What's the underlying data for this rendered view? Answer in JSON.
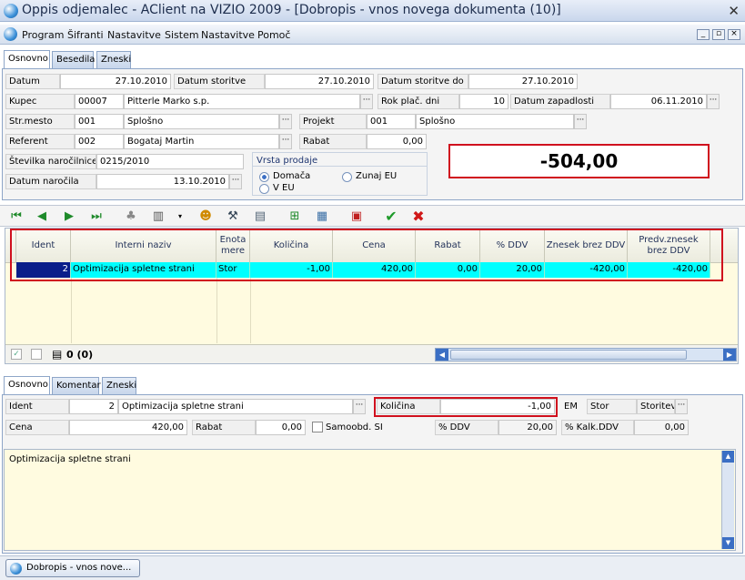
{
  "window": {
    "title": "Oppis odjemalec - AClient na VIZIO 2009 - [Dobropis - vnos novega dokumenta (10)]"
  },
  "menu": [
    "Program",
    "Šifranti",
    "Nastavitve",
    "Sistem",
    "Nastavitve",
    "Pomoč"
  ],
  "top_tabs": [
    "Osnovno",
    "Besedila",
    "Zneski"
  ],
  "header": {
    "datum_label": "Datum",
    "datum_value": "27.10.2010",
    "datum_storitve_label": "Datum storitve",
    "datum_storitve_value": "27.10.2010",
    "datum_storitve_do_label": "Datum storitve do",
    "datum_storitve_do_value": "27.10.2010",
    "kupec_label": "Kupec",
    "kupec_code": "00007",
    "kupec_name": "Pitterle Marko s.p.",
    "rok_label": "Rok plač. dni",
    "rok_value": "10",
    "datum_zapadlosti_label": "Datum zapadlosti",
    "datum_zapadlosti_value": "06.11.2010",
    "strmesto_label": "Str.mesto",
    "strmesto_code": "001",
    "strmesto_name": "Splošno",
    "projekt_label": "Projekt",
    "projekt_code": "001",
    "projekt_name": "Splošno",
    "referent_label": "Referent",
    "referent_code": "002",
    "referent_name": "Bogataj Martin",
    "rabat_label": "Rabat",
    "rabat_value": "0,00",
    "narocilnica_label": "Številka naročilnice",
    "narocilnica_value": "0215/2010",
    "datum_narocila_label": "Datum naročila",
    "datum_narocila_value": "13.10.2010",
    "vrsta_prodaje_label": "Vrsta prodaje",
    "radio_domaca": "Domača",
    "radio_zunaj": "Zunaj EU",
    "radio_veu": "V EU"
  },
  "total": "-504,00",
  "grid": {
    "columns": [
      "Ident",
      "Interni naziv",
      "Enota mere",
      "Količina",
      "Cena",
      "Rabat",
      "% DDV",
      "Znesek brez DDV",
      "Predv.znesek brez DDV"
    ],
    "row": [
      "2",
      "Optimizacija spletne strani",
      "Stor",
      "-1,00",
      "420,00",
      "0,00",
      "20,00",
      "-420,00",
      "-420,00"
    ],
    "footer_count": "0 (0)"
  },
  "bottom_tabs": [
    "Osnovno",
    "Komentar",
    "Zneski"
  ],
  "detail": {
    "ident_label": "Ident",
    "ident_code": "2",
    "ident_name": "Optimizacija spletne strani",
    "kolicina_label": "Količina",
    "kolicina_value": "-1,00",
    "em_label": "EM",
    "em_value": "Stor",
    "em_type": "Storitev",
    "cena_label": "Cena",
    "cena_value": "420,00",
    "rabat_label": "Rabat",
    "rabat_value": "0,00",
    "samoobd_label": "Samoobd. SI",
    "ddv_label": "% DDV",
    "ddv_value": "20,00",
    "kalk_label": "% Kalk.DDV",
    "kalk_value": "0,00"
  },
  "memo": "Optimizacija spletne strani",
  "taskbar": {
    "button": "Dobropis - vnos nove..."
  },
  "colors": {
    "highlight": "#00ffff",
    "annotation_red": "#d0101e",
    "grid_bg": "#fffbe0"
  }
}
